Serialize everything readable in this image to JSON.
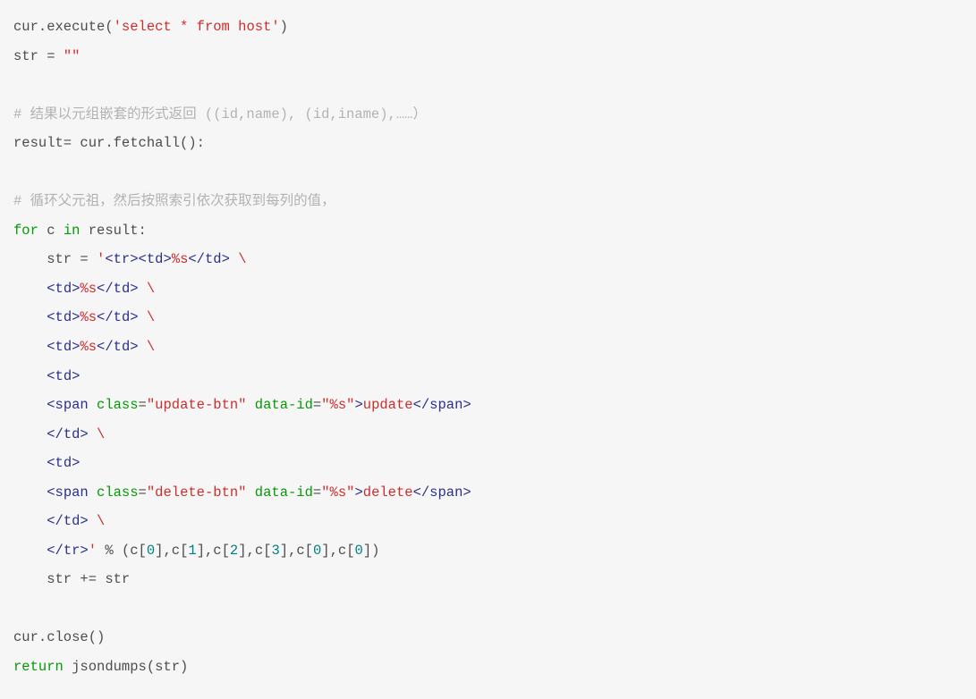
{
  "code": {
    "l1_a": "cur.execute(",
    "l1_b": "'select * from host'",
    "l1_c": ")",
    "l2_a": "str = ",
    "l2_b": "\"\"",
    "l3": "",
    "l4": "# 结果以元组嵌套的形式返回 ((id,name), (id,iname),……）",
    "l5": "result= cur.fetchall():",
    "l6": "",
    "l7": "# 循环父元祖，然后按照索引依次获取到每列的值，",
    "l8_a": "for",
    "l8_b": " c ",
    "l8_c": "in",
    "l8_d": " result:",
    "l9_a": "    str = ",
    "l9_b": "'",
    "l9_c": "<tr>",
    "l9_d": "<td>",
    "l9_e": "%s",
    "l9_f": "</td>",
    "l9_g": " \\",
    "l10_a": "    ",
    "l10_b": "<td>",
    "l10_c": "%s",
    "l10_d": "</td>",
    "l10_e": " \\",
    "l11_a": "    ",
    "l11_b": "<td>",
    "l11_c": "%s",
    "l11_d": "</td>",
    "l11_e": " \\",
    "l12_a": "    ",
    "l12_b": "<td>",
    "l12_c": "%s",
    "l12_d": "</td>",
    "l12_e": " \\",
    "l13_a": "    ",
    "l13_b": "<td>",
    "l14_a": "    ",
    "l14_b": "<span ",
    "l14_c": "class",
    "l14_d": "=",
    "l14_e": "\"update-btn\"",
    "l14_f": " ",
    "l14_g": "data-id",
    "l14_h": "=",
    "l14_i": "\"%s\"",
    "l14_j": ">",
    "l14_k": "update",
    "l14_l": "</span>",
    "l15_a": "    ",
    "l15_b": "</td>",
    "l15_c": " \\",
    "l16_a": "    ",
    "l16_b": "<td>",
    "l17_a": "    ",
    "l17_b": "<span ",
    "l17_c": "class",
    "l17_d": "=",
    "l17_e": "\"delete-btn\"",
    "l17_f": " ",
    "l17_g": "data-id",
    "l17_h": "=",
    "l17_i": "\"%s\"",
    "l17_j": ">",
    "l17_k": "delete",
    "l17_l": "</span>",
    "l18_a": "    ",
    "l18_b": "</td>",
    "l18_c": " \\",
    "l19_a": "    ",
    "l19_b": "</tr>",
    "l19_c": "'",
    "l19_d": " % (c[",
    "l19_e": "0",
    "l19_f": "],c[",
    "l19_g": "1",
    "l19_h": "],c[",
    "l19_i": "2",
    "l19_j": "],c[",
    "l19_k": "3",
    "l19_l": "],c[",
    "l19_m": "0",
    "l19_n": "],c[",
    "l19_o": "0",
    "l19_p": "])",
    "l20": "    str += str",
    "l21": "",
    "l22": "cur.close()",
    "l23_a": "return",
    "l23_b": " jsondumps(str)"
  }
}
